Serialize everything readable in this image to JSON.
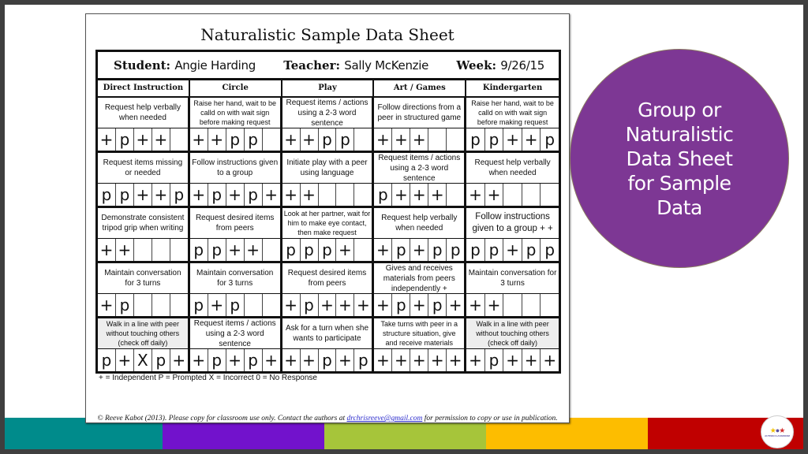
{
  "paper": {
    "title": "Naturalistic Sample Data Sheet",
    "student_label": "Student:",
    "student_name": "Angie Harding",
    "teacher_label": "Teacher:",
    "teacher_name": "Sally McKenzie",
    "week_label": "Week:",
    "week_value": "9/26/15",
    "columns": [
      "Direct Instruction",
      "Circle",
      "Play",
      "Art / Games",
      "Kindergarten"
    ],
    "rows": [
      [
        {
          "goal": "Request help verbally when needed",
          "marks": [
            "+",
            "p",
            "+",
            "+",
            ""
          ]
        },
        {
          "goal": "Raise her hand, wait to be calld on with wait sign before making request",
          "marks": [
            "+",
            "+",
            "p",
            "p",
            ""
          ]
        },
        {
          "goal": "Request items / actions using a 2-3 word sentence",
          "marks": [
            "+",
            "+",
            "p",
            "p",
            ""
          ]
        },
        {
          "goal": "Follow directions from a peer in structured game",
          "marks": [
            "+",
            "+",
            "+",
            "",
            ""
          ]
        },
        {
          "goal": "Raise her hand, wait to be calld on with wait sign before making request",
          "marks": [
            "p",
            "p",
            "+",
            "+",
            "p"
          ]
        }
      ],
      [
        {
          "goal": "Request items missing or needed",
          "marks": [
            "p",
            "p",
            "+",
            "+",
            "p"
          ]
        },
        {
          "goal": "Follow instructions given to a group",
          "marks": [
            "+",
            "p",
            "+",
            "p",
            "+"
          ]
        },
        {
          "goal": "Initiate play with a peer using language",
          "marks": [
            "+",
            "+",
            "",
            "",
            ""
          ]
        },
        {
          "goal": "Request items / actions using a 2-3 word sentence",
          "marks": [
            "p",
            "+",
            "+",
            "+",
            ""
          ]
        },
        {
          "goal": "Request help verbally when needed",
          "marks": [
            "+",
            "+",
            "",
            "",
            ""
          ]
        }
      ],
      [
        {
          "goal": "Demonstrate consistent tripod grip when writing",
          "marks": [
            "+",
            "+",
            "",
            "",
            ""
          ]
        },
        {
          "goal": "Request desired items from peers",
          "marks": [
            "p",
            "p",
            "+",
            "+",
            ""
          ]
        },
        {
          "goal": "Look at her partner, wait for him to make eye contact, then make request",
          "marks": [
            "p",
            "p",
            "p",
            "+",
            ""
          ]
        },
        {
          "goal": "Request help verbally when needed",
          "marks": [
            "+",
            "p",
            "+",
            "p",
            "p"
          ]
        },
        {
          "goal": "Follow instructions given to a group   + +",
          "marks": [
            "p",
            "p",
            "+",
            "p",
            "p"
          ]
        }
      ],
      [
        {
          "goal": "Maintain conversation for 3 turns",
          "marks": [
            "+",
            "p",
            "",
            "",
            ""
          ]
        },
        {
          "goal": "Maintain conversation for 3 turns",
          "marks": [
            "p",
            "+",
            "p",
            "",
            ""
          ]
        },
        {
          "goal": "Request desired items from peers",
          "marks": [
            "+",
            "p",
            "+",
            "+",
            "+"
          ]
        },
        {
          "goal": "Gives and receives materials from peers independently  +",
          "marks": [
            "+",
            "p",
            "+",
            "p",
            "+"
          ]
        },
        {
          "goal": "Maintain conversation for 3 turns",
          "marks": [
            "+",
            "+",
            "",
            "",
            ""
          ]
        }
      ],
      [
        {
          "goal": "Walk in a line with peer without touching others (check off daily)",
          "marks": [
            "p",
            "+",
            "X",
            "p",
            "+"
          ]
        },
        {
          "goal": "Request items / actions using a 2-3 word sentence",
          "marks": [
            "+",
            "p",
            "+",
            "p",
            "+"
          ]
        },
        {
          "goal": "Ask for a turn when she wants to participate",
          "marks": [
            "+",
            "+",
            "p",
            "+",
            "p"
          ]
        },
        {
          "goal": "Take turns with peer in a structure situation, give and receive materials",
          "marks": [
            "+",
            "+",
            "+",
            "+",
            "+"
          ]
        },
        {
          "goal": "Walk in a line with peer without touching others (check off daily)",
          "marks": [
            "+",
            "p",
            "+",
            "+",
            "+"
          ]
        }
      ]
    ],
    "legend": "+ = Independent  P = Prompted  X = Incorrect  0 = No Response",
    "footer_before": "© Reeve Kabot (2013). Please copy for classroom use only. Contact the authors at ",
    "footer_email": "drchrisreeve@gmail.com",
    "footer_after": " for permission to copy or use in publication."
  },
  "callout": {
    "text": "Group or Naturalistic Data Sheet for Sample Data",
    "color": "#7d3794"
  },
  "logo": {
    "icon": "puzzle-stars-icon",
    "text": "AUTISM CLASSROOM"
  },
  "stripes": [
    "#008b8b",
    "#7212cc",
    "#a6c53a",
    "#fdbd00",
    "#c00000"
  ]
}
